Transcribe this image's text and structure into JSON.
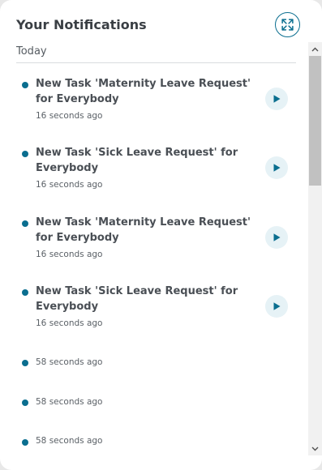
{
  "header": {
    "title": "Your Notifications",
    "expand_icon": "expand-arrows-icon"
  },
  "section": {
    "label": "Today"
  },
  "notifications": [
    {
      "title": "New Task 'Maternity Leave Request' for Everybody",
      "time": "16 seconds ago",
      "has_action": true
    },
    {
      "title": "New Task 'Sick Leave Request' for Everybody",
      "time": "16 seconds ago",
      "has_action": true
    },
    {
      "title": "New Task 'Maternity Leave Request' for Everybody",
      "time": "16 seconds ago",
      "has_action": true
    },
    {
      "title": "New Task 'Sick Leave Request' for Everybody",
      "time": "16 seconds ago",
      "has_action": true
    },
    {
      "title": "",
      "time": "58 seconds ago",
      "has_action": false
    },
    {
      "title": "",
      "time": "58 seconds ago",
      "has_action": false
    },
    {
      "title": "",
      "time": "58 seconds ago",
      "has_action": false
    }
  ],
  "colors": {
    "accent": "#0a6e8f",
    "action_bg": "#e6f2f6",
    "title_text": "#3a3f44"
  },
  "icons": {
    "action": "play-icon",
    "unread": "unread-dot-icon"
  }
}
